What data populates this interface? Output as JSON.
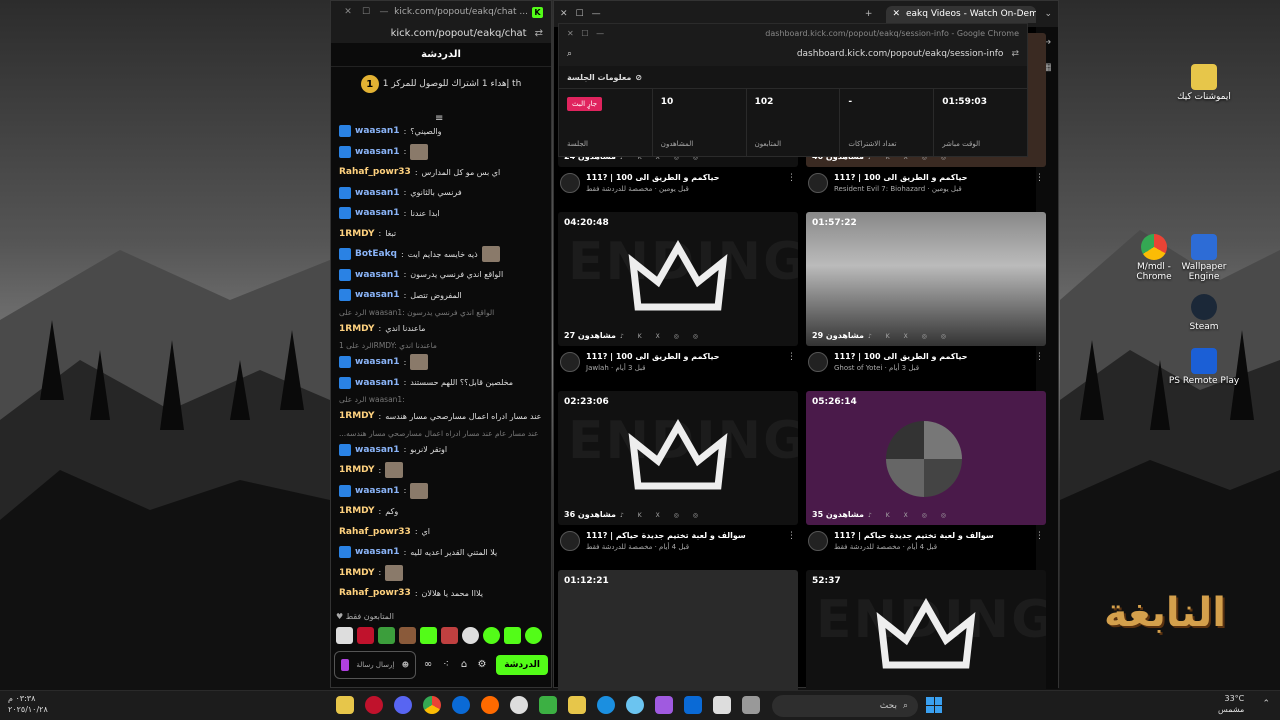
{
  "desktop": {
    "icons": [
      {
        "label": "ايموشنات كيك"
      },
      {
        "label": "M/mdl - Chrome"
      },
      {
        "label": "Wallpaper Engine"
      },
      {
        "label": "Steam"
      },
      {
        "label": "PS Remote Play"
      }
    ],
    "brand": "النابغة"
  },
  "chat_window": {
    "titlebar_url": "kick.com/popout/eakq/chat ...",
    "url": "kick.com/popout/eakq/chat",
    "header": "الدردشة",
    "pinned_rank": "1",
    "pinned_text": "إهداء 1 اشتراك للوصول للمركز 1 th",
    "messages": [
      {
        "user": "waasan1",
        "text": "والصيني؟",
        "color": "#8ab4f8",
        "badge": true
      },
      {
        "user": "waasan1",
        "text": "",
        "emote": true,
        "color": "#8ab4f8",
        "badge": true
      },
      {
        "user": "Rahaf_powr33",
        "text": "اي بس مو كل المدارس",
        "color": "#ffd27f",
        "badge": false
      },
      {
        "user": "waasan1",
        "text": "فرنسي بالثانوي",
        "color": "#8ab4f8",
        "badge": true
      },
      {
        "user": "waasan1",
        "text": "ابدا عندنا",
        "color": "#8ab4f8",
        "badge": true
      },
      {
        "user": "1RMDY",
        "text": "تبغا",
        "color": "#ffd27f",
        "badge": false
      },
      {
        "user": "BotEakq",
        "text": "ذيه خايسه جدايم ايت",
        "emote": true,
        "color": "#8ab4f8",
        "badge": true
      },
      {
        "user": "waasan1",
        "text": "الواقع اندي فرنسي يدرسون",
        "color": "#8ab4f8",
        "badge": true
      },
      {
        "user": "waasan1",
        "text": "المفروض تتصل",
        "color": "#8ab4f8",
        "badge": true
      },
      {
        "reply": "الرد على waasan1: الواقع اندي فرنسي يدرسون"
      },
      {
        "user": "1RMDY",
        "text": "ماعندنا اندي",
        "color": "#ffd27f",
        "badge": false
      },
      {
        "reply": "الرد على 1RMDY: ماعندنا اندي"
      },
      {
        "user": "waasan1",
        "text": "",
        "emote": true,
        "color": "#8ab4f8",
        "badge": true
      },
      {
        "user": "waasan1",
        "text": "مخلصين قابل؟؟ اللهم حسستند",
        "color": "#8ab4f8",
        "badge": true
      },
      {
        "reply": "الرد على waasan1:"
      },
      {
        "user": "1RMDY",
        "text": "عند مسار عام عند مسار ادراه اعمال مسارصحي مسار هندسه",
        "color": "#ffd27f",
        "badge": false
      },
      {
        "reply": "...عند مسار عام عند مسار ادراه اعمال مسارصحي مسار هندسه"
      },
      {
        "user": "waasan1",
        "text": "اوتقر لانربو",
        "color": "#8ab4f8",
        "badge": true
      },
      {
        "user": "1RMDY",
        "text": "",
        "emote": true,
        "color": "#ffd27f",
        "badge": false
      },
      {
        "user": "waasan1",
        "text": "",
        "emote": true,
        "color": "#8ab4f8",
        "badge": true
      },
      {
        "user": "1RMDY",
        "text": "وكم",
        "color": "#ffd27f",
        "badge": false
      },
      {
        "user": "Rahaf_powr33",
        "text": "اي",
        "color": "#ffd27f",
        "badge": false
      },
      {
        "user": "waasan1",
        "text": "يلا المتني القدير اعديه لليه",
        "color": "#8ab4f8",
        "badge": true
      },
      {
        "user": "1RMDY",
        "text": "",
        "emote": true,
        "color": "#ffd27f",
        "badge": false
      },
      {
        "user": "Rahaf_powr33",
        "text": "يلااا محمد يا هلالان",
        "color": "#ffd27f",
        "badge": false
      }
    ],
    "subs_only": "المتابعون فقط",
    "input_placeholder": "إرسال رسالة",
    "send_label": "الدردشة"
  },
  "browser": {
    "tab_title": "eakq Videos - Watch On-Demand",
    "inner_titlebar": "dashboard.kick.com/popout/eakq/session-info - Google Chrome",
    "inner_url": "dashboard.kick.com/popout/eakq/session-info",
    "session_title": "معلومات الجلسة",
    "stats": [
      {
        "value": "جارٍ البث",
        "label": "الجلسة",
        "live": true
      },
      {
        "value": "10",
        "label": "المشاهدون"
      },
      {
        "value": "102",
        "label": "المتابعون"
      },
      {
        "value": "-",
        "label": "تعداد الاشتراكات"
      },
      {
        "value": "01:59:03",
        "label": "الوقت مباشر"
      }
    ],
    "videos": [
      {
        "duration": "",
        "views": "24 مشاهدون",
        "title": "حياكمم و الطريق الى 100 | ?111",
        "sub": "قبل يومين · مخصصة للدردشة فقط"
      },
      {
        "duration": "",
        "views": "40 مشاهدون",
        "title": "حياكمم و الطريق الى 100 | ?111",
        "sub": "Resident Evil 7: Biohazard · قبل يومين"
      },
      {
        "duration": "04:20:48",
        "views": "27 مشاهدون",
        "title": "حياكمم و الطريق الى 100 | ?111",
        "sub": "Jawlah · قبل 3 أيام"
      },
      {
        "duration": "01:57:22",
        "views": "29 مشاهدون",
        "title": "حياكمم و الطريق الى 100 | ?111",
        "sub": "Ghost of Yotei · قبل 3 أيام"
      },
      {
        "duration": "02:23:06",
        "views": "36 مشاهدون",
        "title": "سوالف و لعبة تختيم جديدة حياكم | ?111",
        "sub": "قبل 4 أيام · مخصصة للدردشة فقط"
      },
      {
        "duration": "05:26:14",
        "views": "35 مشاهدون",
        "title": "سوالف و لعبة تختيم جديدة حياكم | ?111",
        "sub": "قبل 4 أيام · مخصصة للدردشة فقط"
      },
      {
        "duration": "01:12:21",
        "views": "",
        "title": "",
        "sub": ""
      },
      {
        "duration": "52:37",
        "views": "",
        "title": "",
        "sub": ""
      }
    ],
    "socials": "♪ K X ◎ ◎"
  },
  "taskbar": {
    "search_placeholder": "بحث",
    "clock_time": "٠٣:٣٨ م",
    "clock_date": "٢٠٢٥/١٠/٢٨",
    "temp": "33°C",
    "weather": "مشمس"
  }
}
